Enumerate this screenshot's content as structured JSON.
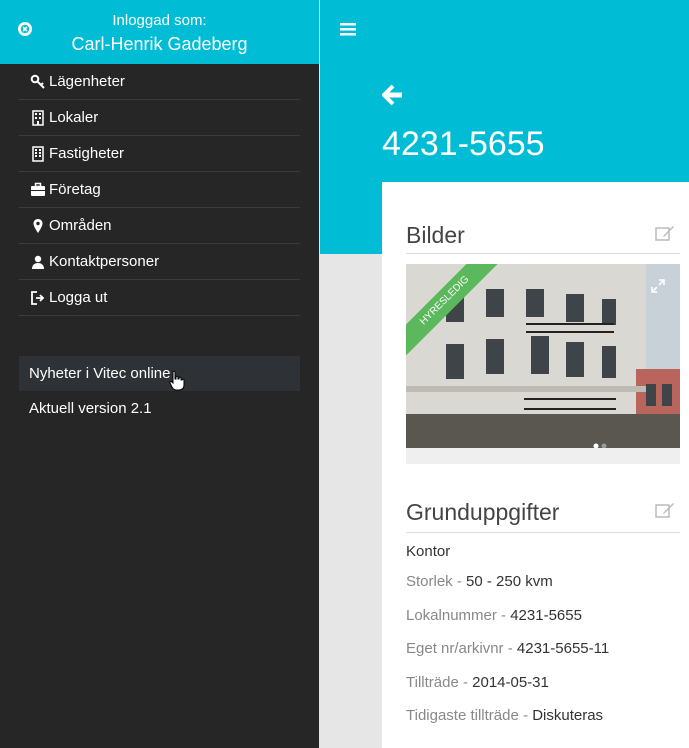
{
  "sidebar": {
    "logged_in_label": "Inloggad som:",
    "user_name": "Carl-Henrik Gadeberg",
    "items": [
      {
        "label": "Lägenheter",
        "icon": "key-icon"
      },
      {
        "label": "Lokaler",
        "icon": "building-icon"
      },
      {
        "label": "Fastigheter",
        "icon": "office-building-icon"
      },
      {
        "label": "Företag",
        "icon": "briefcase-icon"
      },
      {
        "label": "Områden",
        "icon": "map-marker-icon"
      },
      {
        "label": "Kontaktpersoner",
        "icon": "user-icon"
      },
      {
        "label": "Logga ut",
        "icon": "logout-icon"
      }
    ],
    "news_label": "Nyheter i Vitec online",
    "version_label": "Aktuell version 2.1"
  },
  "main": {
    "title": "4231-5655",
    "images_section": {
      "title": "Bilder",
      "ribbon": "HYRESLEDIG"
    },
    "basic_section": {
      "title": "Grunduppgifter",
      "type": "Kontor",
      "fields": [
        {
          "key": "Storlek",
          "value": "50 - 250 kvm"
        },
        {
          "key": "Lokalnummer",
          "value": "4231-5655"
        },
        {
          "key": "Eget nr/arkivnr",
          "value": "4231-5655-11"
        },
        {
          "key": "Tillträde",
          "value": "2014-05-31"
        },
        {
          "key": "Tidigaste tillträde",
          "value": "Diskuteras"
        }
      ]
    }
  },
  "colors": {
    "accent": "#00bcd4",
    "sidebar_bg": "#262626",
    "ribbon": "#5cb85c"
  }
}
